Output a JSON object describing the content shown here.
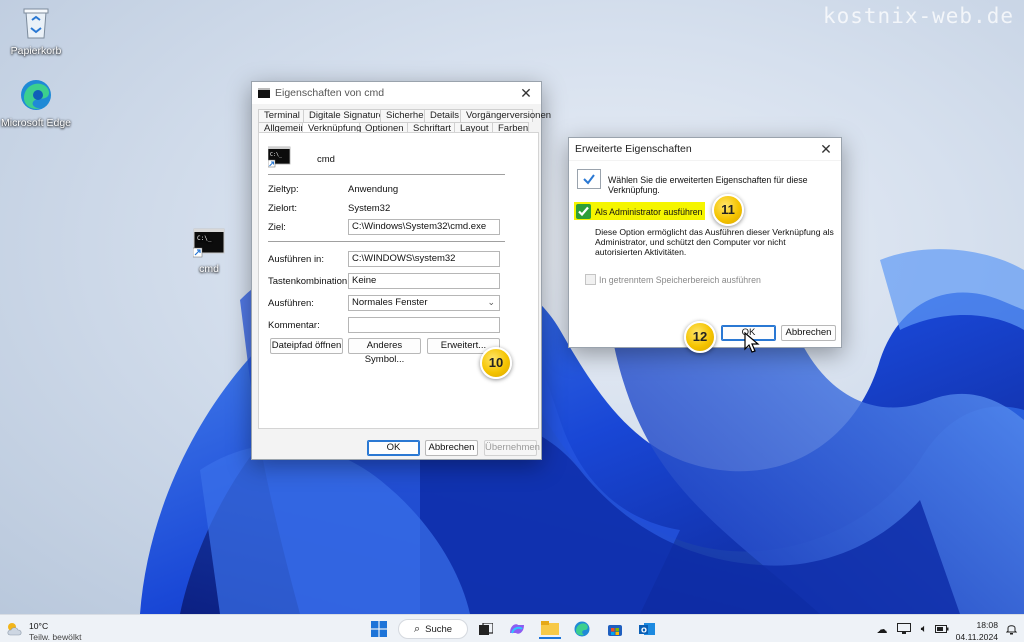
{
  "watermark": "kostnix-web.de",
  "desktop": {
    "icons": [
      {
        "label": "Papierkorb",
        "icon": "recycle-bin-icon"
      },
      {
        "label": "Microsoft Edge",
        "icon": "edge-icon"
      },
      {
        "label": "cmd",
        "icon": "cmd-shortcut-icon"
      }
    ]
  },
  "properties_window": {
    "title": "Eigenschaften von cmd",
    "tabs_row1": [
      "Terminal",
      "Digitale Signaturen",
      "Sicherheit",
      "Details",
      "Vorgängerversionen"
    ],
    "tabs_row2": [
      "Allgemein",
      "Verknüpfung",
      "Optionen",
      "Schriftart",
      "Layout",
      "Farben"
    ],
    "active_tab": "Verknüpfung",
    "name": "cmd",
    "zieltyp_label": "Zieltyp:",
    "zieltyp_value": "Anwendung",
    "zielort_label": "Zielort:",
    "zielort_value": "System32",
    "ziel_label": "Ziel:",
    "ziel_value": "C:\\Windows\\System32\\cmd.exe",
    "ausfuehren_in_label": "Ausführen in:",
    "ausfuehren_in_value": "C:\\WINDOWS\\system32",
    "tasten_label": "Tastenkombination:",
    "tasten_value": "Keine",
    "ausfuehren_label": "Ausführen:",
    "ausfuehren_value": "Normales Fenster",
    "kommentar_label": "Kommentar:",
    "kommentar_value": "",
    "btn_dateipfad": "Dateipfad öffnen",
    "btn_symbol": "Anderes Symbol...",
    "btn_erweitert": "Erweitert...",
    "btn_ok": "OK",
    "btn_abbrechen": "Abbrechen",
    "btn_uebernehmen": "Übernehmen"
  },
  "advanced_dialog": {
    "title": "Erweiterte Eigenschaften",
    "intro": "Wählen Sie die erweiterten Eigenschaften für diese Verknüpfung.",
    "admin_label": "Als Administrator ausführen",
    "admin_checked": true,
    "description": "Diese Option ermöglicht das Ausführen dieser Verknüpfung als Administrator, und schützt den Computer vor nicht autorisierten Aktivitäten.",
    "separate_memory_label": "In getrenntem Speicherbereich ausführen",
    "btn_ok": "OK",
    "btn_abbrechen": "Abbrechen"
  },
  "badges": [
    "10",
    "11",
    "12"
  ],
  "taskbar": {
    "weather_temp": "10°C",
    "weather_desc": "Teilw. bewölkt",
    "search_label": "Suche",
    "time": "18:08",
    "date": "04.11.2024"
  },
  "colors": {
    "highlight": "#f5f500",
    "accent": "#2a78d3",
    "badge": "#f5c400",
    "check_green": "#2e9e3a"
  }
}
